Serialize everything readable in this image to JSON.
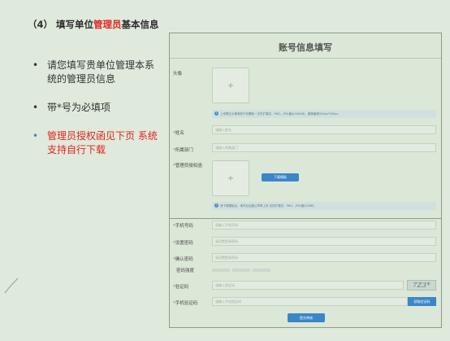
{
  "slide": {
    "title_prefix": "（4） 填写单位",
    "title_highlight": "管理员",
    "title_suffix": "基本信息",
    "bullets": [
      {
        "text": "请您填写贵单位管理本系统的管理员信息"
      },
      {
        "text": "带*号为必填项"
      },
      {
        "text": "管理员授权函见下页 系统支持自行下载"
      }
    ],
    "bullet_marker": "•"
  },
  "form": {
    "title": "账号信息填写",
    "avatar": {
      "label": "头像",
      "upload_glyph": "+",
      "tip": "上传需正头像有胶于完腮脸一文件扩展名：PNG、JPG(最大200KB)，图情最紧200px*200px"
    },
    "name": {
      "label": "姓名",
      "placeholder": "请输入姓名"
    },
    "dept": {
      "label": "所属部门",
      "placeholder": "请输入所属部门"
    },
    "auth": {
      "label": "管理员授权函",
      "upload_glyph": "+",
      "download_button": "下载模板",
      "tip": "请下载模板后，填写后加盖公章再上传 支持扩展名：PNG、JPG(最大2MB)"
    },
    "phone": {
      "label": "手机号码",
      "placeholder": "请输入手机号码"
    },
    "password": {
      "label": "设置密码",
      "placeholder": "请设置登录密码"
    },
    "confirm": {
      "label": "确认密码",
      "placeholder": "请设置登录密码"
    },
    "strength": {
      "label": "密码强度"
    },
    "captcha": {
      "label": "验证码",
      "placeholder": "请输入验证码",
      "code": "7Z3*"
    },
    "sms": {
      "label": "手机验证码",
      "placeholder": "请输入手机验证码",
      "button": "获取验证码"
    },
    "submit": "提交审核",
    "required_mark": "*"
  },
  "colors": {
    "highlight": "#e0261f",
    "accent": "#3a86c9",
    "background": "#dfe9dc"
  }
}
